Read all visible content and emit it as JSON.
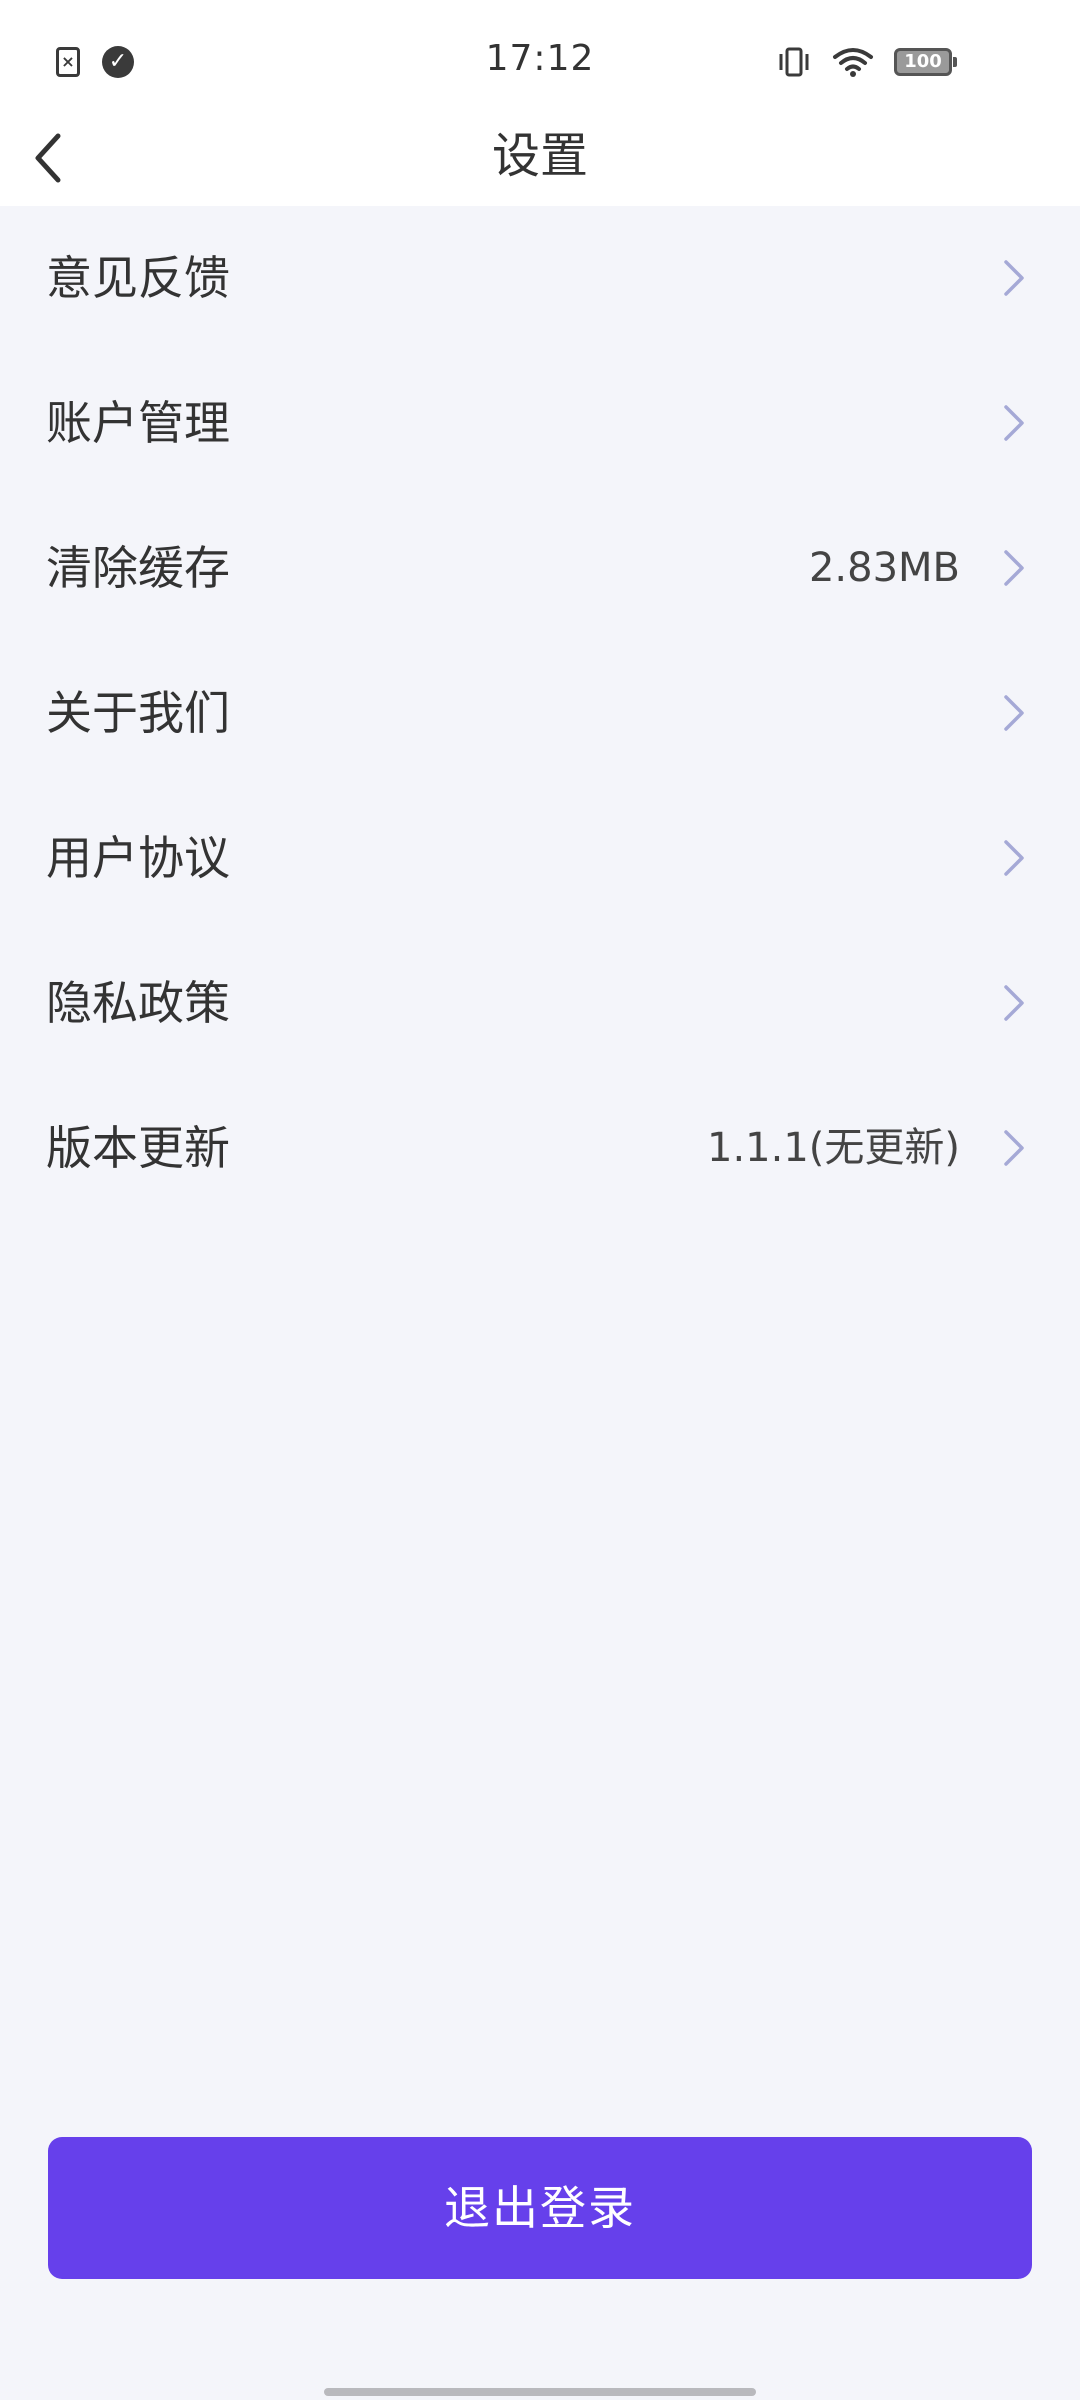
{
  "status_bar": {
    "time": "17:12",
    "battery": "100",
    "icons": [
      "sim-error-icon",
      "check-circle-icon",
      "vibrate-icon",
      "wifi-icon",
      "battery-icon"
    ]
  },
  "header": {
    "title": "设置",
    "back_icon": "chevron-left-icon"
  },
  "menu": {
    "items": [
      {
        "label": "意见反馈",
        "value": ""
      },
      {
        "label": "账户管理",
        "value": ""
      },
      {
        "label": "清除缓存",
        "value": "2.83MB"
      },
      {
        "label": "关于我们",
        "value": ""
      },
      {
        "label": "用户协议",
        "value": ""
      },
      {
        "label": "隐私政策",
        "value": ""
      },
      {
        "label": "版本更新",
        "value": "1.1.1(无更新)"
      }
    ]
  },
  "logout": {
    "label": "退出登录"
  },
  "colors": {
    "accent": "#6640eb",
    "background": "#f4f5fa",
    "chevron": "#a5a9d6"
  }
}
